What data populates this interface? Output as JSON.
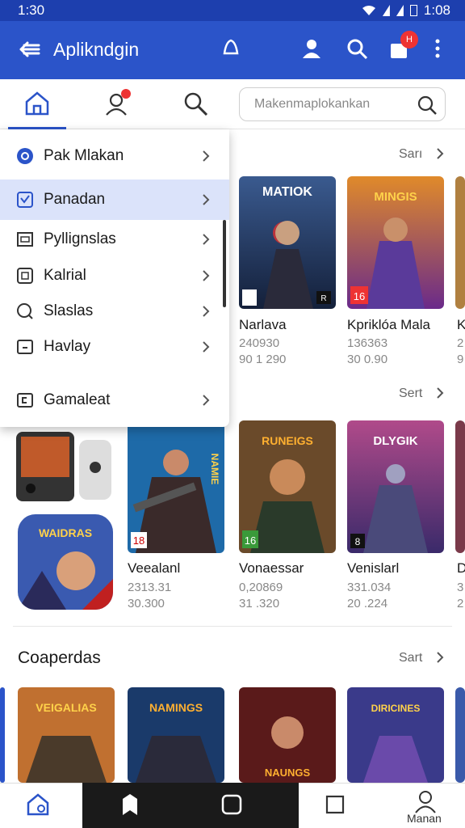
{
  "status_bar": {
    "time": "1:30",
    "time_right": "1:08"
  },
  "app_bar": {
    "title": "Aplikndgin",
    "cart_badge": "H"
  },
  "search": {
    "placeholder": "Makenmaplokankan"
  },
  "menu": {
    "items": [
      {
        "label": "Pak Mlakan",
        "icon": "circle-o-icon"
      },
      {
        "label": "Panadan",
        "icon": "tag-icon",
        "selected": true
      },
      {
        "label": "Pyllignslas",
        "icon": "window-icon"
      },
      {
        "label": "Kalrial",
        "icon": "square-icon"
      },
      {
        "label": "Slaslas",
        "icon": "search-small-icon"
      },
      {
        "label": "Havlay",
        "icon": "frame-icon"
      },
      {
        "label": "Gamaleat",
        "icon": "game-icon"
      }
    ]
  },
  "sections": [
    {
      "link": "Sarı",
      "cards": [
        {
          "title": "Narlava",
          "line1": "240930",
          "line2": "90 1 290",
          "art": "MATIOK",
          "rating": "R"
        },
        {
          "title": "Kpriklóa Mala",
          "line1": "136363",
          "line2": "30 0.90",
          "art": "MINGIS",
          "rating": "16"
        },
        {
          "title": "K",
          "line1": "2",
          "line2": "9"
        }
      ]
    },
    {
      "link": "Sert",
      "cards": [
        {
          "title": "Veealanl",
          "line1": "2313.31",
          "line2": "30.300",
          "art": "NAMIE",
          "rating": "18"
        },
        {
          "title": "Vonaessar",
          "line1": "0,20869",
          "line2": "31 .320",
          "art": "RUNEIGS",
          "rating": "16"
        },
        {
          "title": "Venislarl",
          "line1": "331.034",
          "line2": "20 .224",
          "art": "DLYGIK",
          "rating": "8"
        },
        {
          "title": "D",
          "line1": "3",
          "line2": "2"
        }
      ],
      "extra_art": "WAIDRAS"
    },
    {
      "title": "Coaperdas",
      "link": "Sart",
      "cards": [
        {
          "art": "VEIGALIAS"
        },
        {
          "art": "NAMINGS"
        },
        {
          "art": "NAUNGS"
        },
        {
          "art": "DIRICINES"
        }
      ]
    }
  ],
  "bottom_nav": {
    "label": "Manan"
  }
}
